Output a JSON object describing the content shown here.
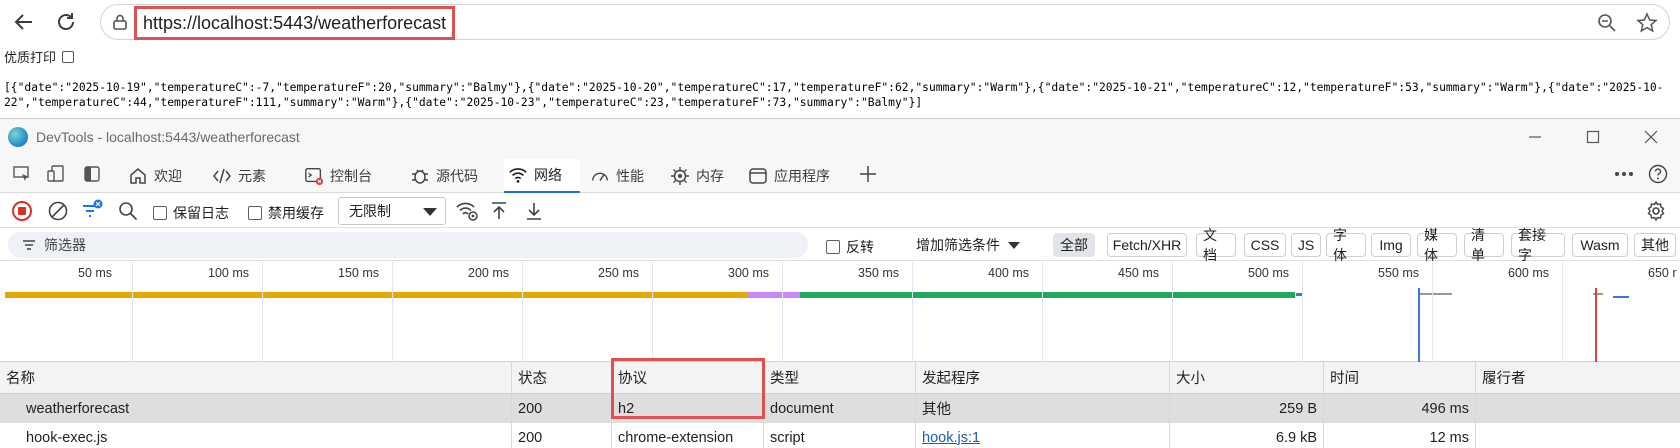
{
  "browser": {
    "url": "https://localhost:5443/weatherforecast"
  },
  "page": {
    "pretty_print_label": "优质打印",
    "json_line1": "[{\"date\":\"2025-10-19\",\"temperatureC\":-7,\"temperatureF\":20,\"summary\":\"Balmy\"},{\"date\":\"2025-10-20\",\"temperatureC\":17,\"temperatureF\":62,\"summary\":\"Warm\"},{\"date\":\"2025-10-21\",\"temperatureC\":12,\"temperatureF\":53,\"summary\":\"Warm\"},{\"date\":\"2025-10-",
    "json_line2": "22\",\"temperatureC\":44,\"temperatureF\":111,\"summary\":\"Warm\"},{\"date\":\"2025-10-23\",\"temperatureC\":23,\"temperatureF\":73,\"summary\":\"Balmy\"}]"
  },
  "devtools": {
    "title": "DevTools - localhost:5443/weatherforecast",
    "tabs": [
      {
        "label": "欢迎",
        "icon": "home-icon"
      },
      {
        "label": "元素",
        "icon": "code-icon"
      },
      {
        "label": "控制台",
        "icon": "console-icon"
      },
      {
        "label": "源代码",
        "icon": "bug-icon"
      },
      {
        "label": "网络",
        "icon": "wifi-icon"
      },
      {
        "label": "性能",
        "icon": "gauge-icon"
      },
      {
        "label": "内存",
        "icon": "chip-icon"
      },
      {
        "label": "应用程序",
        "icon": "window-icon"
      }
    ],
    "toolbar": {
      "preserve_log": "保留日志",
      "disable_cache": "禁用缓存",
      "throttling": "无限制"
    },
    "filter": {
      "placeholder": "筛选器",
      "invert": "反转",
      "more_filters": "增加筛选条件",
      "chips": [
        "全部",
        "Fetch/XHR",
        "文档",
        "CSS",
        "JS",
        "字体",
        "Img",
        "媒体",
        "清单",
        "套接字",
        "Wasm",
        "其他"
      ]
    },
    "timeline": {
      "ticks": [
        "50 ms",
        "100 ms",
        "150 ms",
        "200 ms",
        "250 ms",
        "300 ms",
        "350 ms",
        "400 ms",
        "450 ms",
        "500 ms",
        "550 ms",
        "600 ms",
        "650 r"
      ],
      "colors": {
        "waiting": "#e8a600",
        "stalled": "#c58af9",
        "download": "#1eaa5a",
        "dcl": "#3a78d8",
        "load": "#e04040"
      }
    },
    "table": {
      "headers": [
        "名称",
        "状态",
        "协议",
        "类型",
        "发起程序",
        "大小",
        "时间",
        "履行者"
      ],
      "rows": [
        {
          "name": "weatherforecast",
          "status": "200",
          "protocol": "h2",
          "type": "document",
          "initiator": "其他",
          "size": "259 B",
          "time": "496 ms",
          "fulfilled": ""
        },
        {
          "name": "hook-exec.js",
          "status": "200",
          "protocol": "chrome-extension",
          "type": "script",
          "initiator": "hook.js:1",
          "size": "6.9 kB",
          "time": "12 ms",
          "fulfilled": ""
        }
      ]
    }
  }
}
